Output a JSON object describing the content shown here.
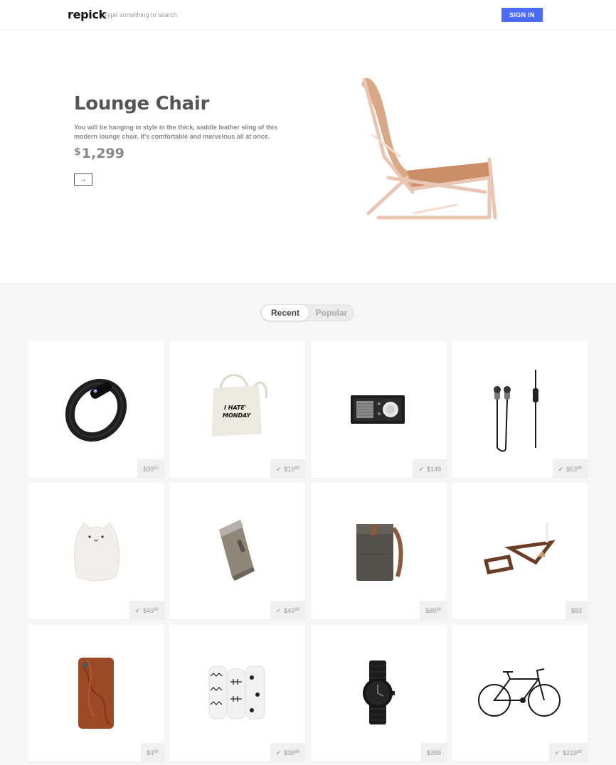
{
  "header": {
    "logo": "repick",
    "search_placeholder": "Type something to search",
    "signin_label": "SIGN IN"
  },
  "hero": {
    "title": "Lounge Chair",
    "description": "You will be hanging in style in the thick, saddle leather sling of this modern lounge chair. It's comfortable and marvelous all at once.",
    "currency": "$",
    "price": "1,299",
    "arrow": "→"
  },
  "tabs": {
    "recent": "Recent",
    "popular": "Popular"
  },
  "products": [
    {
      "name": "fitness-band",
      "dollars": "$39",
      "cents": "50",
      "checked": false
    },
    {
      "name": "tote-bag",
      "dollars": "$19",
      "cents": "99",
      "checked": true
    },
    {
      "name": "radio",
      "dollars": "$149",
      "cents": "",
      "checked": true
    },
    {
      "name": "earphones",
      "dollars": "$53",
      "cents": "95",
      "checked": true
    },
    {
      "name": "cat-lamp",
      "dollars": "$49",
      "cents": "99",
      "checked": true
    },
    {
      "name": "speaker",
      "dollars": "$49",
      "cents": "99",
      "checked": true
    },
    {
      "name": "backpack",
      "dollars": "$89",
      "cents": "99",
      "checked": false
    },
    {
      "name": "shelves",
      "dollars": "$83",
      "cents": "",
      "checked": false
    },
    {
      "name": "phone-case",
      "dollars": "$4",
      "cents": "99",
      "checked": false
    },
    {
      "name": "blankets",
      "dollars": "$38",
      "cents": "99",
      "checked": true
    },
    {
      "name": "watch",
      "dollars": "$399",
      "cents": "",
      "checked": false
    },
    {
      "name": "bicycle",
      "dollars": "$219",
      "cents": "99",
      "checked": true
    }
  ],
  "colors": {
    "accent": "#4a6cf7",
    "section_bg": "#f6f6f6"
  },
  "icons": {
    "check": "check-icon",
    "arrow": "arrow-right-icon"
  }
}
